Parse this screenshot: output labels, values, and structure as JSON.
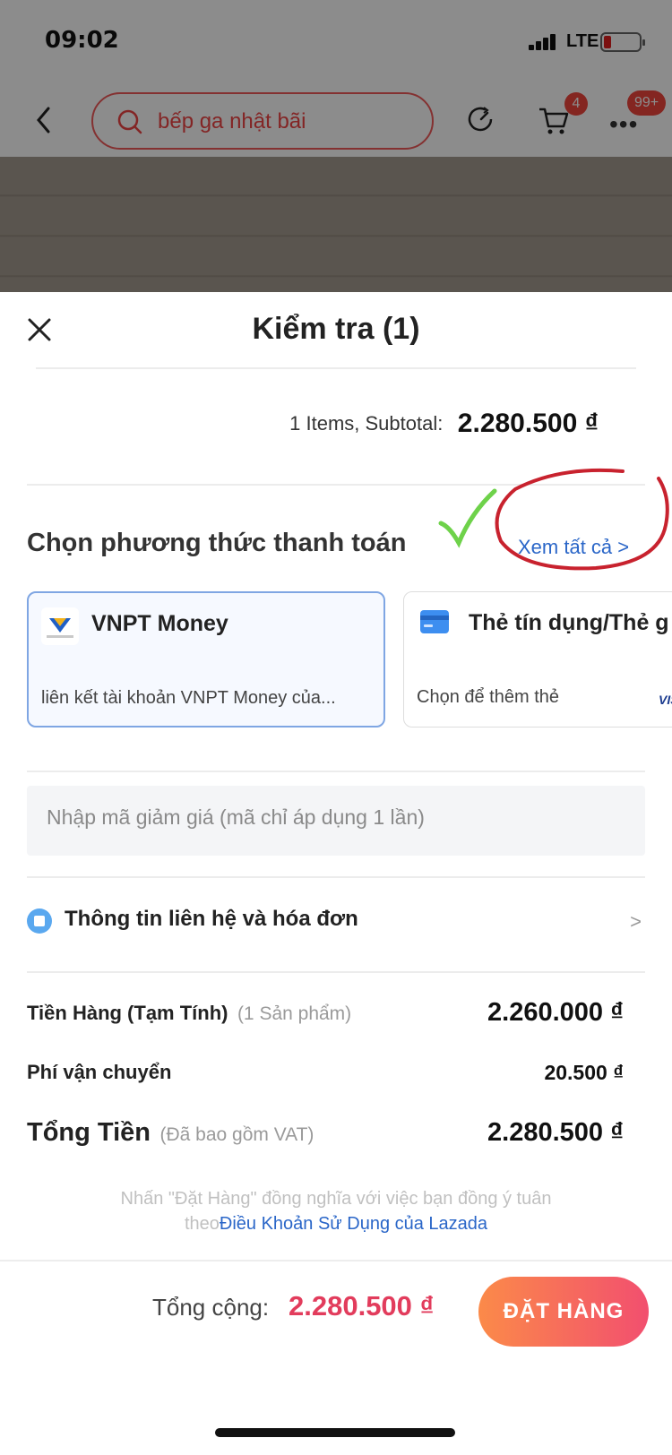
{
  "status_bar": {
    "time": "09:02",
    "network": "LTE"
  },
  "background_app": {
    "search_text": "bếp ga nhật bãi",
    "cart_badge": "4",
    "more_badge": "99+"
  },
  "sheet": {
    "title": "Kiểm tra (1)",
    "subtotal_label": "1 Items, Subtotal:",
    "subtotal_value": "2.280.500 ₫",
    "payment_title": "Chọn phương thức thanh toán",
    "see_all": "Xem tất cả >",
    "payment_methods": [
      {
        "name": "VNPT Money",
        "sub": "liên kết tài khoản VNPT Money của...",
        "icon": "vnpt-money-logo"
      },
      {
        "name": "Thẻ tín dụng/Thẻ g",
        "sub": "Chọn để thêm thẻ",
        "badge": "VISA",
        "icon": "credit-card-icon"
      }
    ],
    "promo_placeholder": "Nhập mã giảm giá (mã chỉ áp dụng 1 lần)",
    "contact_label": "Thông tin liên hệ và hóa đơn",
    "summary": {
      "goods_label": "Tiền Hàng (Tạm Tính)",
      "goods_note": "(1 Sản phẩm)",
      "goods_value": "2.260.000 ₫",
      "shipping_label": "Phí vận chuyển",
      "shipping_value": "20.500 ₫",
      "total_label": "Tổng Tiền",
      "total_note": "(Đã bao gồm VAT)",
      "total_value": "2.280.500 ₫"
    },
    "terms_line1": "Nhấn \"Đặt Hàng\" đồng nghĩa với việc bạn đồng ý tuân",
    "terms_prefix": "theo",
    "terms_link": "Điều Khoản Sử Dụng của Lazada"
  },
  "footer": {
    "total_label": "Tổng cộng:",
    "total_value": "2.280.500 ₫",
    "order_button": "ĐẶT HÀNG"
  },
  "colors": {
    "accent_red": "#e23c5c",
    "link_blue": "#2a66c8",
    "button_gradient_start": "#fb8a49",
    "button_gradient_end": "#f24f6f"
  }
}
